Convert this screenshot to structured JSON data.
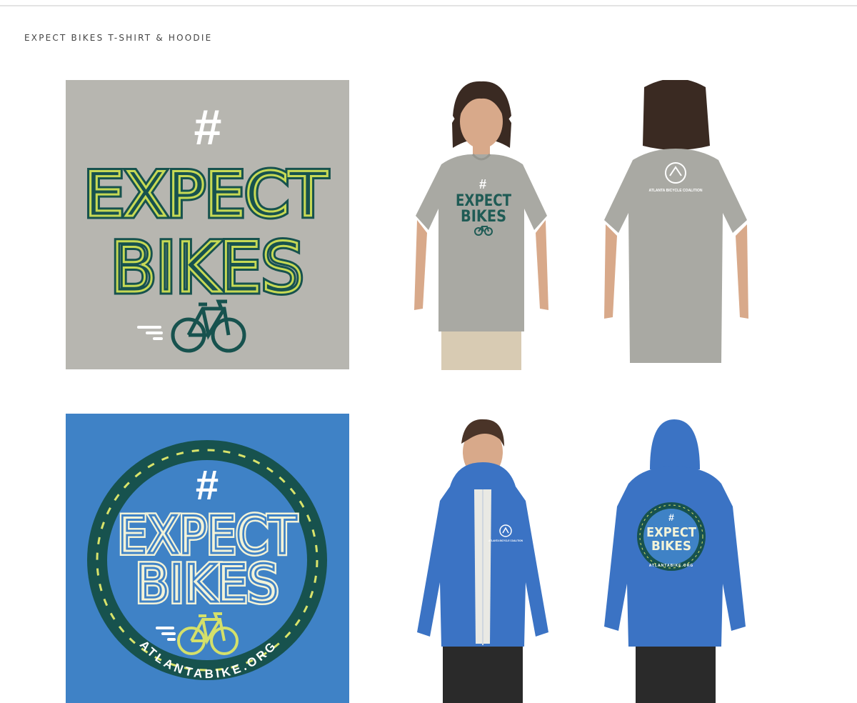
{
  "page": {
    "title": "EXPECT BIKES T-SHIRT & HOODIE"
  },
  "designs": {
    "tee": {
      "hashtag": "#",
      "line1": "EXPECT",
      "line2": "BIKES",
      "background": "#b7b6b0",
      "text_outer": "#17524e",
      "text_inner": "#c6d955",
      "bike_color": "#17524e"
    },
    "hoodie": {
      "hashtag": "#",
      "line1": "EXPECT",
      "line2": "BIKES",
      "url": "ATLANTABIKE.ORG",
      "background": "#3f82c6",
      "ring": "#17524e",
      "dash": "#d9e36a",
      "text_outer": "#f3f3d8",
      "text_inner": "#d4e06a",
      "bike_color": "#d4e06a"
    }
  },
  "mockups": {
    "tee_front": {
      "hashtag": "#",
      "line1": "EXPECT",
      "line2": "BIKES",
      "shirt_color": "#a9a9a3"
    },
    "tee_back": {
      "logo_text": "ATLANTA BICYCLE COALITION",
      "shirt_color": "#a9a9a3"
    },
    "hoodie_front": {
      "logo_text": "ATLANTA BICYCLE COALITION",
      "hoodie_color": "#3b73c4"
    },
    "hoodie_back": {
      "hashtag": "#",
      "line1": "EXPECT",
      "line2": "BIKES",
      "url": "ATLANTABIKE.ORG",
      "hoodie_color": "#3b73c4"
    }
  }
}
